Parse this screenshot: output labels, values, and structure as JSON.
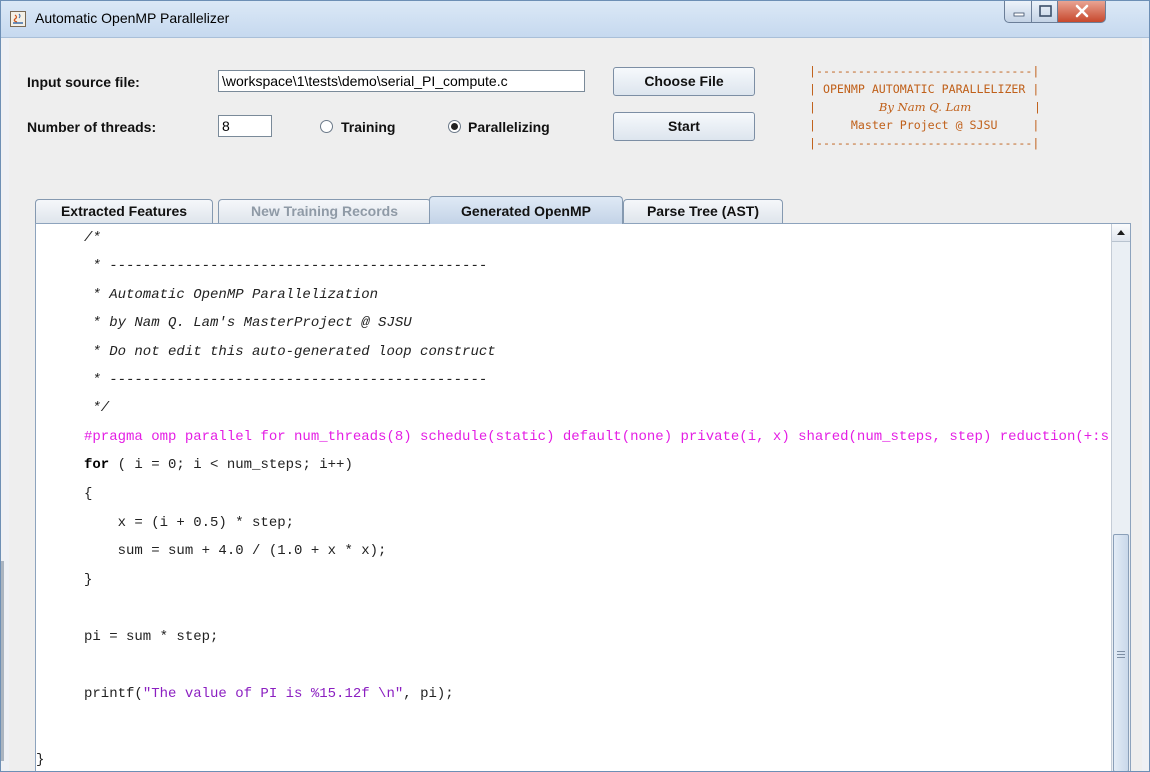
{
  "window": {
    "title": "Automatic OpenMP Parallelizer"
  },
  "form": {
    "input_label": "Input source file:",
    "input_value": "\\workspace\\1\\tests\\demo\\serial_PI_compute.c",
    "choose_file_label": "Choose File",
    "threads_label": "Number of threads:",
    "threads_value": "8",
    "mode_training_label": "Training",
    "mode_parallelizing_label": "Parallelizing",
    "mode_selected": "Parallelizing",
    "start_label": "Start"
  },
  "banner": {
    "rule": "|-------------------------------|",
    "line_title": "| OPENMP AUTOMATIC PARALLELIZER |",
    "line_author": "By Nam Q. Lam",
    "line_project": "Master Project @ SJSU"
  },
  "tabs": [
    {
      "label": "Extracted Features",
      "state": "enabled"
    },
    {
      "label": "New Training Records",
      "state": "disabled"
    },
    {
      "label": "Generated OpenMP",
      "state": "selected"
    },
    {
      "label": "Parse Tree (AST)",
      "state": "enabled"
    }
  ],
  "code": {
    "comment_open": "/*",
    "comment_rule": " * ---------------------------------------------",
    "comment_l1": " * Automatic OpenMP Parallelization",
    "comment_l2": " * by Nam Q. Lam's MasterProject @ SJSU",
    "comment_l3": " * Do not edit this auto-generated loop construct",
    "comment_close": " */",
    "pragma": "#pragma omp parallel for num_threads(8) schedule(static) default(none) private(i, x) shared(num_steps, step) reduction(+:sum)",
    "for_keyword": "for",
    "for_rest": " ( i = 0; i < num_steps; i++)",
    "open_brace": "{",
    "stmt1": "    x = (i + 0.5) * step;",
    "stmt2": "    sum = sum + 4.0 / (1.0 + x * x);",
    "close_brace": "}",
    "pi_assign": "pi = sum * step;",
    "printf_call": "printf(",
    "printf_string": "\"The value of PI is %15.12f \\n\"",
    "printf_rest": ", pi);",
    "function_close": "}"
  },
  "colors": {
    "pragma": "#e41ee4",
    "string": "#8b1fc1",
    "banner": "#c0601a",
    "close_button": "#c7482d"
  }
}
